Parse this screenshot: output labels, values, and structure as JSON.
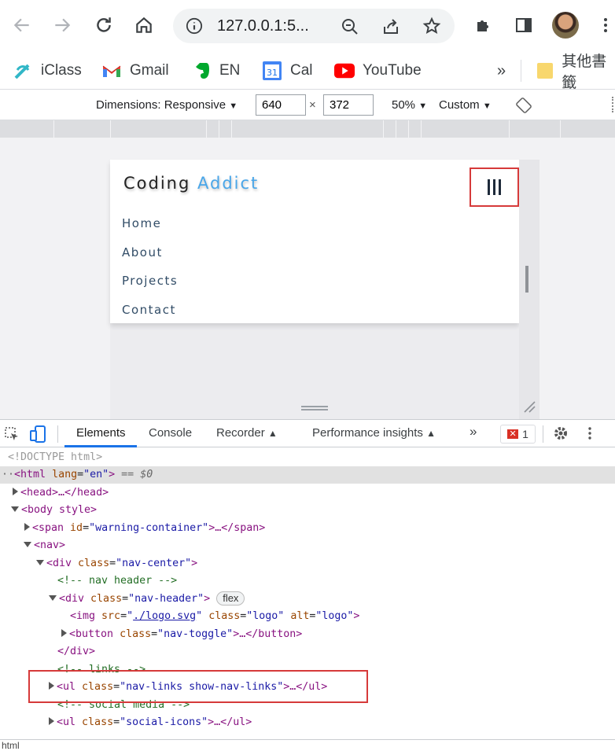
{
  "browser": {
    "url": "127.0.0.1:5...",
    "bookmarks": [
      {
        "label": "iClass",
        "icon": "iclass-icon"
      },
      {
        "label": "Gmail",
        "icon": "gmail-icon"
      },
      {
        "label": "EN",
        "icon": "evernote-icon"
      },
      {
        "label": "Cal",
        "icon": "calendar-icon"
      },
      {
        "label": "YouTube",
        "icon": "youtube-icon"
      }
    ],
    "more_bookmarks": "»",
    "other_bookmarks": "其他書籤"
  },
  "device_toolbar": {
    "dimensions_label": "Dimensions: Responsive",
    "width": "640",
    "times": "×",
    "height": "372",
    "zoom": "50%",
    "throttle": "Custom"
  },
  "page": {
    "logo_part1": "Coding",
    "logo_part2": "Addict",
    "links": [
      "Home",
      "About",
      "Projects",
      "Contact"
    ]
  },
  "devtools": {
    "tabs": [
      "Elements",
      "Console",
      "Recorder",
      "Performance insights"
    ],
    "more_tabs": "»",
    "error_count": "1",
    "status": "html",
    "dom": {
      "doctype": "<!DOCTYPE html>",
      "html_open": "<html",
      "html_attr": "lang",
      "html_val": "\"en\"",
      "html_close": ">",
      "html_eq": "== $0",
      "head": "<head>…</head>",
      "body_open": "<body style>",
      "span_open": "<span",
      "span_attr": "id",
      "span_val": "\"warning-container\"",
      "span_close": ">…</span>",
      "nav_open": "<nav>",
      "div_open": "<div",
      "class_attr": "class",
      "nav_center_val": "\"nav-center\"",
      "tag_gt": ">",
      "comment_header": "<!-- nav header -->",
      "nav_header_val": "\"nav-header\"",
      "flex": "flex",
      "img_open": "<img",
      "src_attr": "src",
      "src_val": "./logo.svg",
      "logo_val": "\"logo\"",
      "alt_attr": "alt",
      "img_close": ">",
      "button_open": "<button",
      "nav_toggle_val": "\"nav-toggle\"",
      "button_close": ">…</button>",
      "div_close": "</div>",
      "comment_links": "<!-- links -->",
      "ul_open": "<ul",
      "nav_links_val": "\"nav-links show-nav-links\"",
      "ul_close": ">…</ul>",
      "comment_social": "<!-- social media -->",
      "social_val": "\"social-icons\""
    }
  }
}
